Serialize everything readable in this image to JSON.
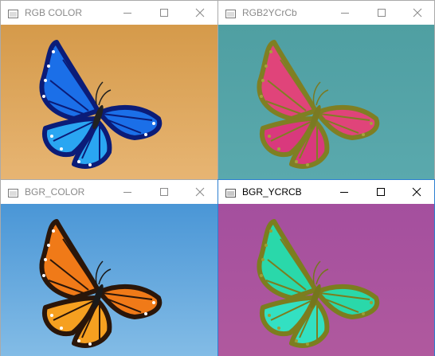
{
  "windows": [
    {
      "title": "RGB COLOR",
      "active": false,
      "bg_top": "#d59a4a",
      "bg_bottom": "#e7b573",
      "wing_dark": "#0b1c78",
      "wing_fill": "#1b6fe8",
      "wing_hi": "#2aa6f2",
      "spot": "#ffffff",
      "body": "#222222",
      "controls": [
        "minimize-icon",
        "maximize-icon",
        "close-icon"
      ]
    },
    {
      "title": "RGB2YCrCb",
      "active": false,
      "bg_top": "#4f9fa2",
      "bg_bottom": "#5aa9ad",
      "wing_dark": "#7f7f23",
      "wing_fill": "#e0447a",
      "wing_hi": "#d9397d",
      "spot": "#a4a43b",
      "body": "#7a7a22",
      "controls": [
        "minimize-icon",
        "maximize-icon",
        "close-icon"
      ]
    },
    {
      "title": "BGR_COLOR",
      "active": false,
      "bg_top": "#4a96d6",
      "bg_bottom": "#83bce6",
      "wing_dark": "#2a160a",
      "wing_fill": "#f07a18",
      "wing_hi": "#f6a020",
      "spot": "#ffffff",
      "body": "#1a1a1a",
      "controls": [
        "minimize-icon",
        "maximize-icon",
        "close-icon"
      ]
    },
    {
      "title": "BGR_YCRCB",
      "active": true,
      "bg_top": "#a44f9e",
      "bg_bottom": "#b0599e",
      "wing_dark": "#7c7d1f",
      "wing_fill": "#2ad8aa",
      "wing_hi": "#33e0c2",
      "spot": "#9d9e35",
      "body": "#75761d",
      "controls": [
        "minimize-icon",
        "maximize-icon",
        "close-icon"
      ]
    }
  ]
}
